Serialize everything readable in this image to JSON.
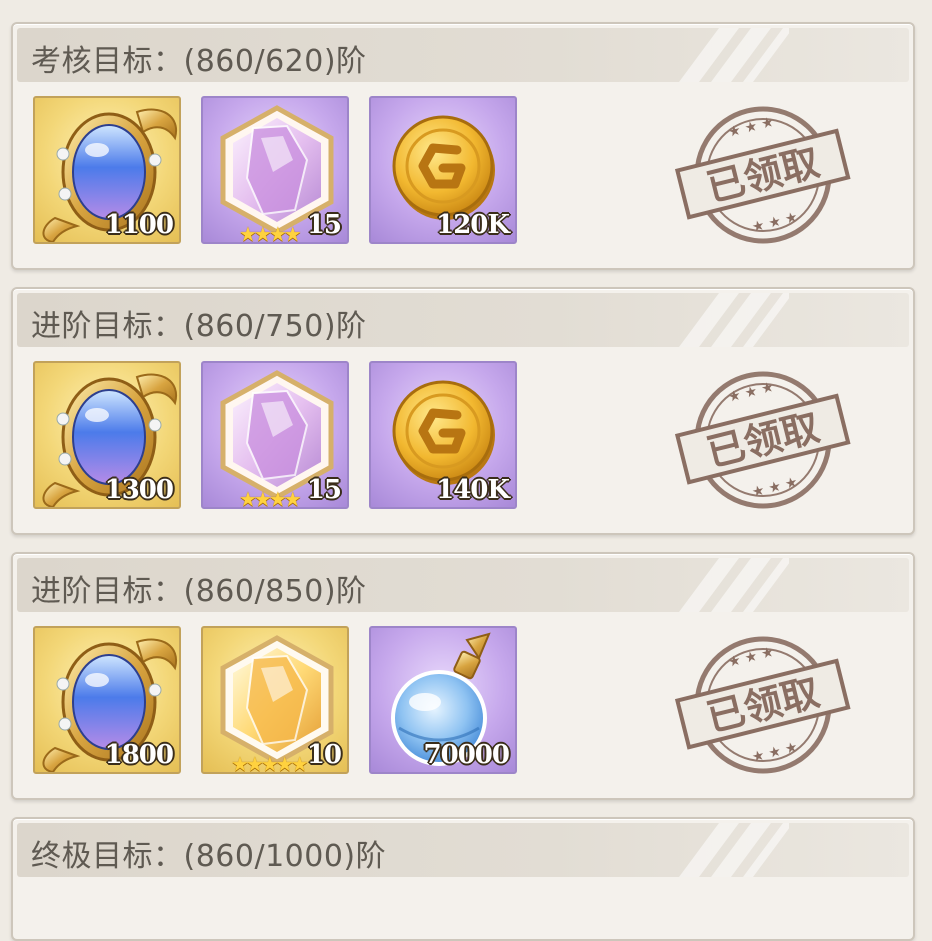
{
  "colors": {
    "panel_bg": "#efebe4",
    "card_bg": "#f4f1ec",
    "header_text": "#5f5a52",
    "stamp": "#8a6e62",
    "gold_slot": "#f3d778",
    "purple_slot": "#c6a8ec"
  },
  "cards": [
    {
      "title": "考核目标：(860/620)阶",
      "stamp_label": "已领取",
      "items": [
        {
          "icon": "blue-gem-mirror-icon",
          "qty": "1100",
          "stars": ""
        },
        {
          "icon": "purple-crystal-icon",
          "qty": "15",
          "stars": "★★★★"
        },
        {
          "icon": "gold-coin-icon",
          "qty": "120K",
          "stars": ""
        }
      ]
    },
    {
      "title": "进阶目标：(860/750)阶",
      "stamp_label": "已领取",
      "items": [
        {
          "icon": "blue-gem-mirror-icon",
          "qty": "1300",
          "stars": ""
        },
        {
          "icon": "purple-crystal-icon",
          "qty": "15",
          "stars": "★★★★"
        },
        {
          "icon": "gold-coin-icon",
          "qty": "140K",
          "stars": ""
        }
      ]
    },
    {
      "title": "进阶目标：(860/850)阶",
      "stamp_label": "已领取",
      "items": [
        {
          "icon": "blue-gem-mirror-icon",
          "qty": "1800",
          "stars": ""
        },
        {
          "icon": "gold-crystal-icon",
          "qty": "10",
          "stars": "★★★★★"
        },
        {
          "icon": "blue-potion-icon",
          "qty": "70000",
          "stars": ""
        }
      ]
    },
    {
      "title": "终极目标：(860/1000)阶"
    }
  ]
}
